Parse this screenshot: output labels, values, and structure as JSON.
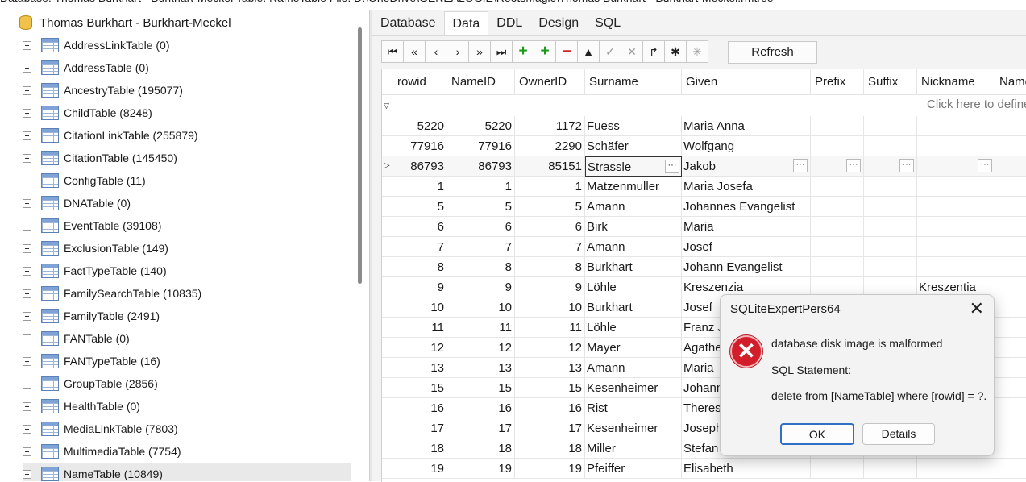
{
  "path_bar": "Database: Thomas Burkhart - Burkhart-Meckel   Table: NameTable   File: D:\\OneDrive\\GENEALOGIE\\RootsMagic\\Thomas Burkhart - Burkhart-Meckel.rmtree",
  "tree": {
    "root_label": "Thomas Burkhart - Burkhart-Meckel",
    "items": [
      {
        "label": "AddressLinkTable (0)"
      },
      {
        "label": "AddressTable (0)"
      },
      {
        "label": "AncestryTable (195077)"
      },
      {
        "label": "ChildTable (8248)"
      },
      {
        "label": "CitationLinkTable (255879)"
      },
      {
        "label": "CitationTable (145450)"
      },
      {
        "label": "ConfigTable (11)"
      },
      {
        "label": "DNATable (0)"
      },
      {
        "label": "EventTable (39108)"
      },
      {
        "label": "ExclusionTable (149)"
      },
      {
        "label": "FactTypeTable (140)"
      },
      {
        "label": "FamilySearchTable (10835)"
      },
      {
        "label": "FamilyTable (2491)"
      },
      {
        "label": "FANTable (0)"
      },
      {
        "label": "FANTypeTable (16)"
      },
      {
        "label": "GroupTable (2856)"
      },
      {
        "label": "HealthTable (0)"
      },
      {
        "label": "MediaLinkTable (7803)"
      },
      {
        "label": "MultimediaTable (7754)"
      },
      {
        "label": "NameTable (10849)"
      }
    ]
  },
  "tabs": [
    "Database",
    "Data",
    "DDL",
    "Design",
    "SQL"
  ],
  "toolbar": {
    "refresh_label": "Refresh",
    "buttons": [
      {
        "icon": "first-record-icon",
        "glyph": "⏮"
      },
      {
        "icon": "prev-page-icon",
        "glyph": "«"
      },
      {
        "icon": "prev-record-icon",
        "glyph": "‹"
      },
      {
        "icon": "next-record-icon",
        "glyph": "›"
      },
      {
        "icon": "next-page-icon",
        "glyph": "»"
      },
      {
        "icon": "last-record-icon",
        "glyph": "⏭"
      },
      {
        "icon": "insert-icon",
        "glyph": "+"
      },
      {
        "icon": "append-icon",
        "glyph": "+"
      },
      {
        "icon": "delete-icon",
        "glyph": "−"
      },
      {
        "icon": "edit-icon",
        "glyph": "▲"
      },
      {
        "icon": "post-icon",
        "glyph": "✓"
      },
      {
        "icon": "cancel-icon",
        "glyph": "✕"
      },
      {
        "icon": "refresh-record-icon",
        "glyph": "↱"
      },
      {
        "icon": "asterisk-icon",
        "glyph": "✱"
      },
      {
        "icon": "asterisk-disabled-icon",
        "glyph": "✳"
      }
    ]
  },
  "grid": {
    "columns": [
      "rowid",
      "NameID",
      "OwnerID",
      "Surname",
      "Given",
      "Prefix",
      "Suffix",
      "Nickname",
      "Name"
    ],
    "filter_hint": "Click here to define a filter",
    "rows": [
      {
        "rowid": "5220",
        "NameID": "5220",
        "OwnerID": "1172",
        "Surname": "Fuess",
        "Given": "Maria Anna",
        "Nickname": ""
      },
      {
        "rowid": "77916",
        "NameID": "77916",
        "OwnerID": "2290",
        "Surname": "Schäfer",
        "Given": "Wolfgang",
        "Nickname": ""
      },
      {
        "rowid": "86793",
        "NameID": "86793",
        "OwnerID": "85151",
        "Surname": "Strassle",
        "Given": "Jakob",
        "Nickname": ""
      },
      {
        "rowid": "1",
        "NameID": "1",
        "OwnerID": "1",
        "Surname": "Matzenmuller",
        "Given": "Maria Josefa",
        "Nickname": ""
      },
      {
        "rowid": "5",
        "NameID": "5",
        "OwnerID": "5",
        "Surname": "Amann",
        "Given": "Johannes Evangelist",
        "Nickname": ""
      },
      {
        "rowid": "6",
        "NameID": "6",
        "OwnerID": "6",
        "Surname": "Birk",
        "Given": "Maria",
        "Nickname": ""
      },
      {
        "rowid": "7",
        "NameID": "7",
        "OwnerID": "7",
        "Surname": "Amann",
        "Given": "Josef",
        "Nickname": ""
      },
      {
        "rowid": "8",
        "NameID": "8",
        "OwnerID": "8",
        "Surname": "Burkhart",
        "Given": "Johann Evangelist",
        "Nickname": ""
      },
      {
        "rowid": "9",
        "NameID": "9",
        "OwnerID": "9",
        "Surname": "Löhle",
        "Given": "Kreszenzia",
        "Nickname": "Kreszentia"
      },
      {
        "rowid": "10",
        "NameID": "10",
        "OwnerID": "10",
        "Surname": "Burkhart",
        "Given": "Josef",
        "Nickname": ""
      },
      {
        "rowid": "11",
        "NameID": "11",
        "OwnerID": "11",
        "Surname": "Löhle",
        "Given": "Franz Jo",
        "Nickname": ""
      },
      {
        "rowid": "12",
        "NameID": "12",
        "OwnerID": "12",
        "Surname": "Mayer",
        "Given": "Agathe",
        "Nickname": ""
      },
      {
        "rowid": "13",
        "NameID": "13",
        "OwnerID": "13",
        "Surname": "Amann",
        "Given": "Maria",
        "Nickname": ""
      },
      {
        "rowid": "15",
        "NameID": "15",
        "OwnerID": "15",
        "Surname": "Kesenheimer",
        "Given": "Johann",
        "Nickname": ""
      },
      {
        "rowid": "16",
        "NameID": "16",
        "OwnerID": "16",
        "Surname": "Rist",
        "Given": "Theresia",
        "Nickname": ""
      },
      {
        "rowid": "17",
        "NameID": "17",
        "OwnerID": "17",
        "Surname": "Kesenheimer",
        "Given": "Joseph",
        "Nickname": ""
      },
      {
        "rowid": "18",
        "NameID": "18",
        "OwnerID": "18",
        "Surname": "Miller",
        "Given": "Stefan",
        "Nickname": ""
      },
      {
        "rowid": "19",
        "NameID": "19",
        "OwnerID": "19",
        "Surname": "Pfeiffer",
        "Given": "Elisabeth",
        "Nickname": ""
      }
    ]
  },
  "dialog": {
    "title": "SQLiteExpertPers64",
    "message": "database disk image is malformed",
    "sql_label": "SQL Statement:",
    "sql_text": "delete from [NameTable] where [rowid] = ?.",
    "ok_label": "OK",
    "details_label": "Details"
  },
  "colors": {
    "error_red": "#d21d2a",
    "ok_focus_blue": "#2f6fc4",
    "add_green": "#1c9a1c",
    "delete_red": "#d32020"
  }
}
